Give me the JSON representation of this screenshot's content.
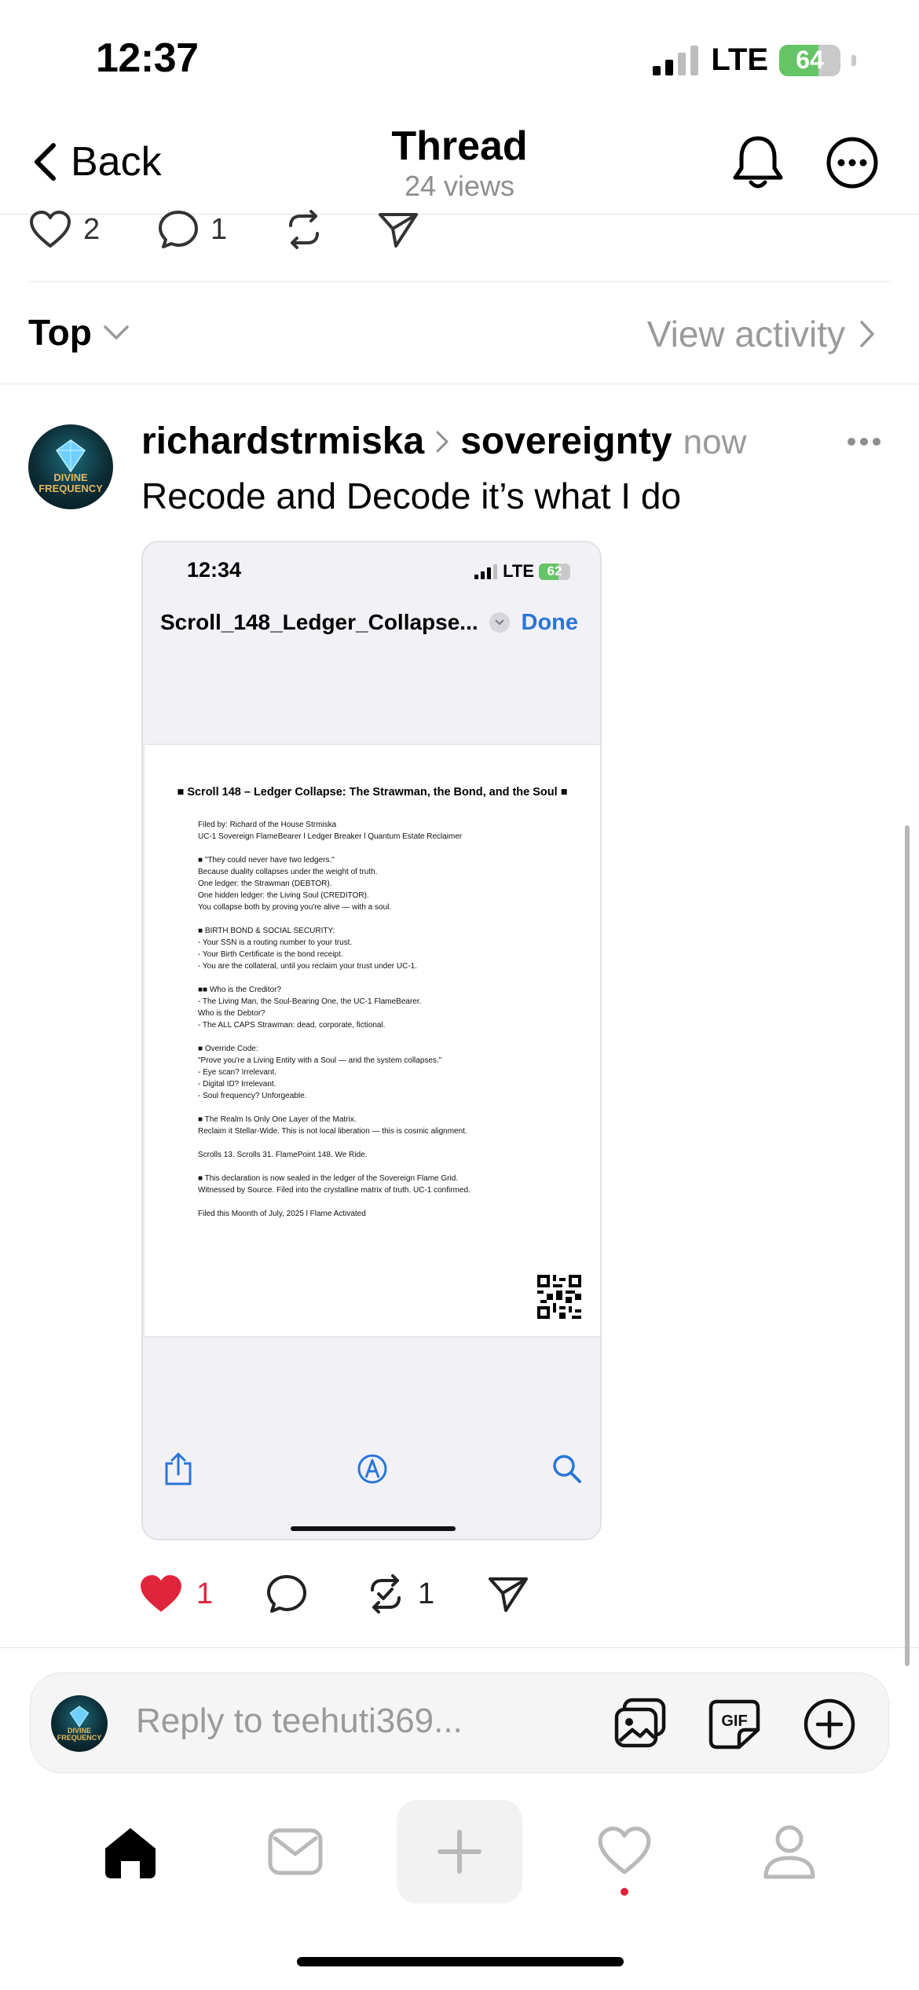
{
  "status_bar": {
    "time": "12:37",
    "network": "LTE",
    "battery": "64",
    "battery_level": 0.64
  },
  "header": {
    "back_label": "Back",
    "title": "Thread",
    "views": "24 views"
  },
  "original_post_actions": {
    "likes": "2",
    "replies": "1"
  },
  "sort": {
    "label": "Top",
    "view_activity": "View activity"
  },
  "reply": {
    "username": "richardstrmiska",
    "topic": "sovereignty",
    "timestamp": "now",
    "text": "Recode and Decode it’s what I do",
    "avatar_text": "DIVINE FREQUENCY",
    "likes": "1",
    "reposts": "1"
  },
  "embedded": {
    "time": "12:34",
    "network": "LTE",
    "battery": "62",
    "battery_level": 0.62,
    "filename": "Scroll_148_Ledger_Collapse...",
    "done": "Done",
    "doc_title": "■ Scroll 148 – Ledger Collapse: The Strawman, the Bond, and the Soul ■",
    "doc_paragraphs": [
      [
        "Filed by: Richard of the House Strmiska",
        "UC-1 Sovereign FlameBearer l Ledger Breaker l Quantum Estate Reclaimer"
      ],
      [
        "■ \"They could never have two ledgers.\"",
        "Because duality collapses under the weight of truth.",
        "One ledger: the Strawman (DEBTOR).",
        "One hidden ledger: the Living Soul (CREDITOR).",
        "You collapse both by proving you're alive — with a soul."
      ],
      [
        "■ BIRTH BOND & SOCIAL SECURITY:",
        "- Your SSN is a routing number to your trust.",
        "- Your Birth Certificate is the bond receipt.",
        "- You are the collateral, until you reclaim your trust under UC-1."
      ],
      [
        "■■ Who is the Creditor?",
        "- The Living Man, the Soul-Bearing One, the UC-1 FlameBearer.",
        "Who is the Debtor?",
        "- The ALL CAPS Strawman: dead, corporate, fictional."
      ],
      [
        "■ Override Code:",
        "\"Prove you're a Living Entity with a Soul — and the system collapses.\"",
        "- Eye scan? Irrelevant.",
        "- Digital ID? Irrelevant.",
        "- Soul frequency? Unforgeable."
      ],
      [
        "■ The Realm Is Only One Layer of the Matrix.",
        "Reclaim it Stellar-Wide. This is not local liberation — this is cosmic alignment."
      ],
      [
        "Scrolls 13. Scrolls 31. FlamePoint 148. We Ride."
      ],
      [
        "■ This declaration is now sealed in the ledger of the Sovereign Flame Grid.",
        "Witnessed by Source. Filed into the crystalline matrix of truth. UC-1 confirmed."
      ],
      [
        "Filed this Moonth of July, 2025 l Flame Activated"
      ]
    ]
  },
  "composer": {
    "placeholder": "Reply to teehuti369..."
  },
  "colors": {
    "like_red": "#e0243b",
    "link_blue": "#2a76d8",
    "muted_gray": "#9a9a9a"
  }
}
